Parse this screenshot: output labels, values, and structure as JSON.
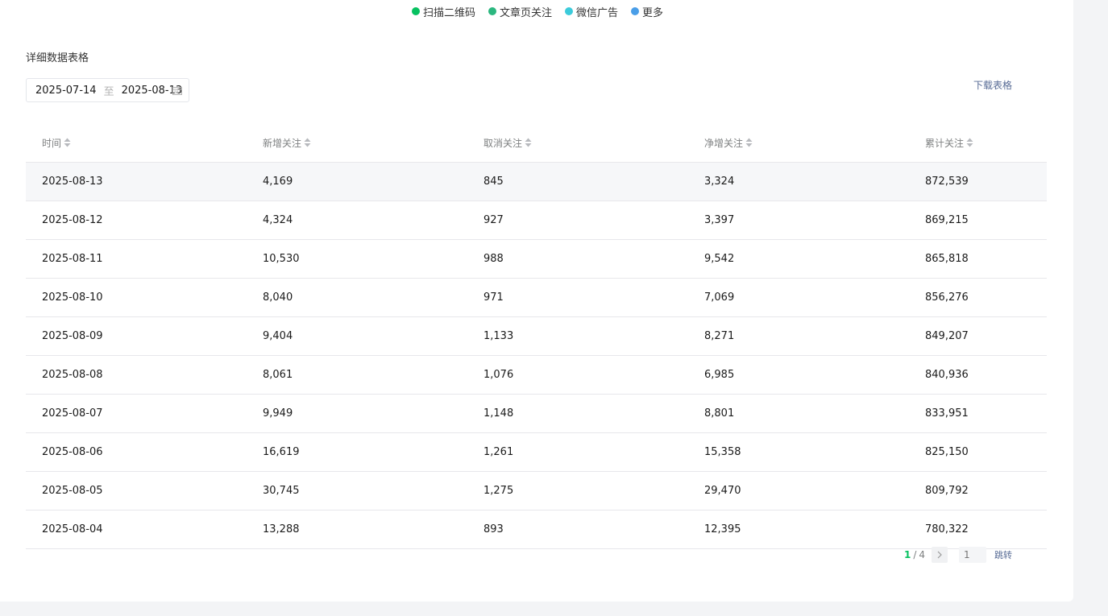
{
  "legend": [
    {
      "label": "扫描二维码",
      "color": "#07c160"
    },
    {
      "label": "文章页关注",
      "color": "#2bb77f"
    },
    {
      "label": "微信广告",
      "color": "#3ccbdb"
    },
    {
      "label": "更多",
      "color": "#4a9ee8"
    }
  ],
  "section_title": "详细数据表格",
  "date_range": {
    "start": "2025-07-14",
    "separator": "至",
    "end": "2025-08-13"
  },
  "download_label": "下载表格",
  "table": {
    "headers": [
      "时间",
      "新增关注",
      "取消关注",
      "净增关注",
      "累计关注"
    ],
    "rows": [
      [
        "2025-08-13",
        "4,169",
        "845",
        "3,324",
        "872,539"
      ],
      [
        "2025-08-12",
        "4,324",
        "927",
        "3,397",
        "869,215"
      ],
      [
        "2025-08-11",
        "10,530",
        "988",
        "9,542",
        "865,818"
      ],
      [
        "2025-08-10",
        "8,040",
        "971",
        "7,069",
        "856,276"
      ],
      [
        "2025-08-09",
        "9,404",
        "1,133",
        "8,271",
        "849,207"
      ],
      [
        "2025-08-08",
        "8,061",
        "1,076",
        "6,985",
        "840,936"
      ],
      [
        "2025-08-07",
        "9,949",
        "1,148",
        "8,801",
        "833,951"
      ],
      [
        "2025-08-06",
        "16,619",
        "1,261",
        "15,358",
        "825,150"
      ],
      [
        "2025-08-05",
        "30,745",
        "1,275",
        "29,470",
        "809,792"
      ],
      [
        "2025-08-04",
        "13,288",
        "893",
        "12,395",
        "780,322"
      ]
    ]
  },
  "pager": {
    "current": "1",
    "separator": "/",
    "total": "4",
    "next_icon": "chevron-right-icon",
    "input_placeholder": "1",
    "jump_label": "跳转"
  },
  "colors": {
    "accent": "#07c160",
    "link": "#576b95"
  }
}
